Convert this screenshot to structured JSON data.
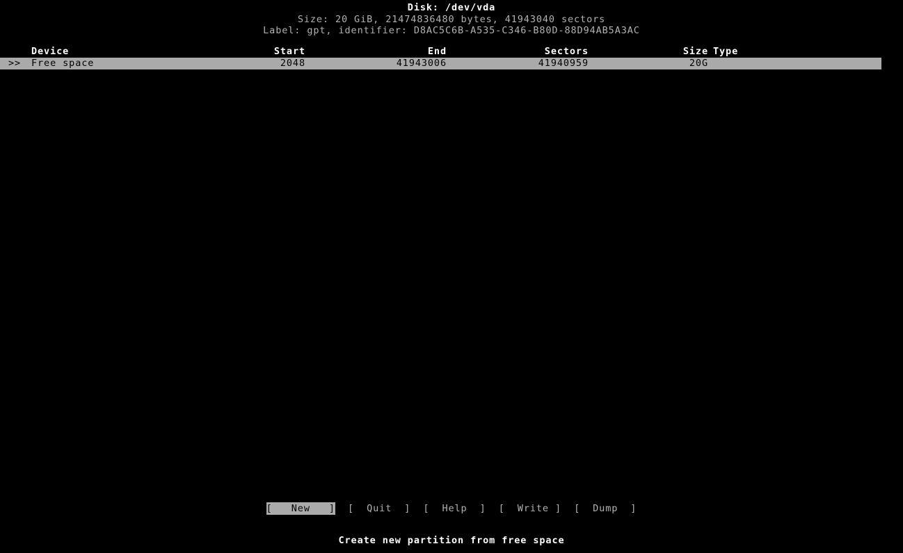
{
  "header": {
    "title": "Disk: /dev/vda",
    "size_line": "Size: 20 GiB, 21474836480 bytes, 41943040 sectors",
    "label_line": "Label: gpt, identifier: D8AC5C6B-A535-C346-B80D-88D94AB5A3AC"
  },
  "table": {
    "columns": {
      "device": "Device",
      "start": "Start",
      "end": "End",
      "sectors": "Sectors",
      "size": "Size",
      "type": "Type"
    },
    "rows": [
      {
        "cursor": ">>",
        "device": "Free space",
        "start": "2048",
        "end": "41943006",
        "sectors": "41940959",
        "size": "20G",
        "type": "",
        "selected": true
      }
    ]
  },
  "menu": {
    "buttons": [
      {
        "bracket_open": "[",
        "label": "New",
        "bracket_close": "]",
        "selected": true
      },
      {
        "bracket_open": "[",
        "label": "Quit",
        "bracket_close": "]",
        "selected": false
      },
      {
        "bracket_open": "[",
        "label": "Help",
        "bracket_close": "]",
        "selected": false
      },
      {
        "bracket_open": "[",
        "label": "Write",
        "bracket_close": "]",
        "selected": false
      },
      {
        "bracket_open": "[",
        "label": "Dump",
        "bracket_close": "]",
        "selected": false
      }
    ],
    "new_text": "[   New   ]",
    "quit_text": "[  Quit  ]",
    "help_text": "[  Help  ]",
    "write_text": "[  Write ]",
    "dump_text": "[  Dump  ]",
    "gap": "  "
  },
  "hint": "Create new partition from free space",
  "colors": {
    "background": "#000000",
    "normal_text": "#b2b2b2",
    "bright_text": "#ffffff",
    "highlight_bg": "#aaaaaa",
    "highlight_text": "#000000"
  }
}
